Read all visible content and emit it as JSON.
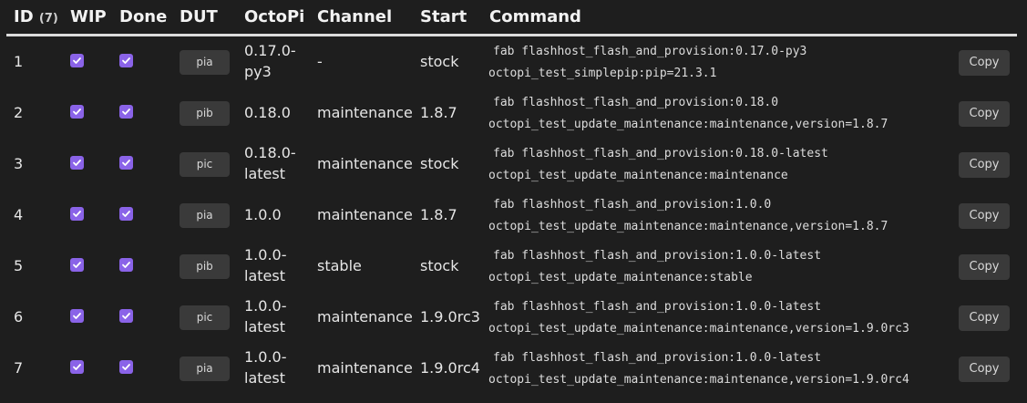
{
  "header": {
    "id": "ID",
    "id_count": "(7)",
    "wip": "WIP",
    "done": "Done",
    "dut": "DUT",
    "octopi": "OctoPi",
    "channel": "Channel",
    "start": "Start",
    "command": "Command"
  },
  "accent_color": "#8a63e8",
  "icons": {
    "checkbox": "checkbox-checked-icon"
  },
  "rows": [
    {
      "id": "1",
      "wip": true,
      "done": true,
      "dut": "pia",
      "octopi": [
        "0.17.0-",
        "py3"
      ],
      "channel": "-",
      "start": "stock",
      "cmd1": "fab flashhost_flash_and_provision:0.17.0-py3",
      "cmd2": "octopi_test_simplepip:pip=21.3.1",
      "copy": "Copy"
    },
    {
      "id": "2",
      "wip": true,
      "done": true,
      "dut": "pib",
      "octopi": [
        "0.18.0"
      ],
      "channel": "maintenance",
      "start": "1.8.7",
      "cmd1": "fab flashhost_flash_and_provision:0.18.0",
      "cmd2": "octopi_test_update_maintenance:maintenance,version=1.8.7",
      "copy": "Copy"
    },
    {
      "id": "3",
      "wip": true,
      "done": true,
      "dut": "pic",
      "octopi": [
        "0.18.0-",
        "latest"
      ],
      "channel": "maintenance",
      "start": "stock",
      "cmd1": "fab flashhost_flash_and_provision:0.18.0-latest",
      "cmd2": "octopi_test_update_maintenance:maintenance",
      "copy": "Copy"
    },
    {
      "id": "4",
      "wip": true,
      "done": true,
      "dut": "pia",
      "octopi": [
        "1.0.0"
      ],
      "channel": "maintenance",
      "start": "1.8.7",
      "cmd1": "fab flashhost_flash_and_provision:1.0.0",
      "cmd2": "octopi_test_update_maintenance:maintenance,version=1.8.7",
      "copy": "Copy"
    },
    {
      "id": "5",
      "wip": true,
      "done": true,
      "dut": "pib",
      "octopi": [
        "1.0.0-",
        "latest"
      ],
      "channel": "stable",
      "start": "stock",
      "cmd1": "fab flashhost_flash_and_provision:1.0.0-latest",
      "cmd2": "octopi_test_update_maintenance:stable",
      "copy": "Copy"
    },
    {
      "id": "6",
      "wip": true,
      "done": true,
      "dut": "pic",
      "octopi": [
        "1.0.0-",
        "latest"
      ],
      "channel": "maintenance",
      "start": "1.9.0rc3",
      "cmd1": "fab flashhost_flash_and_provision:1.0.0-latest",
      "cmd2": "octopi_test_update_maintenance:maintenance,version=1.9.0rc3",
      "copy": "Copy"
    },
    {
      "id": "7",
      "wip": true,
      "done": true,
      "dut": "pia",
      "octopi": [
        "1.0.0-",
        "latest"
      ],
      "channel": "maintenance",
      "start": "1.9.0rc4",
      "cmd1": "fab flashhost_flash_and_provision:1.0.0-latest",
      "cmd2": "octopi_test_update_maintenance:maintenance,version=1.9.0rc4",
      "copy": "Copy"
    }
  ]
}
